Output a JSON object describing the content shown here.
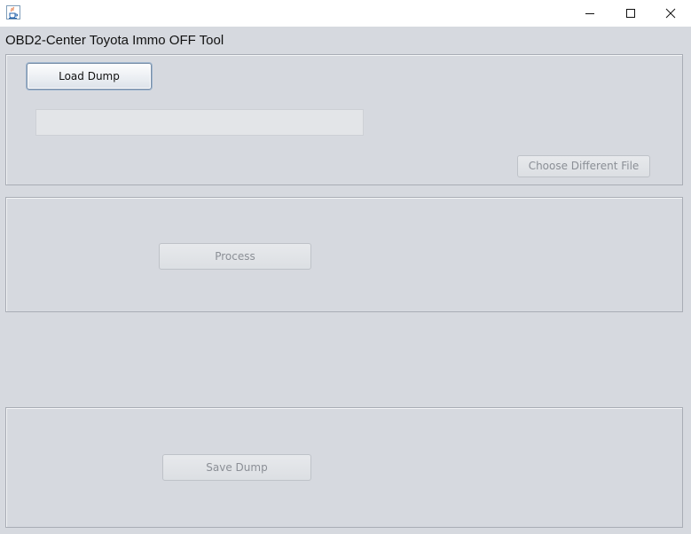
{
  "window": {
    "app_icon": "java-coffee-cup-icon",
    "controls": {
      "minimize_icon": "minimize-icon",
      "maximize_icon": "maximize-icon",
      "close_icon": "close-icon"
    }
  },
  "app": {
    "title": "OBD2-Center Toyota Immo OFF Tool"
  },
  "load_panel": {
    "load_button_label": "Load Dump",
    "file_path_value": "",
    "choose_button_label": "Choose Different File"
  },
  "process_panel": {
    "process_button_label": "Process"
  },
  "save_panel": {
    "save_button_label": "Save Dump"
  },
  "colors": {
    "background": "#d6d9df",
    "titlebar": "#ffffff",
    "panel_border": "#a9adb5",
    "disabled_text": "#8b8f96",
    "active_button_border": "#7a8fa8"
  }
}
